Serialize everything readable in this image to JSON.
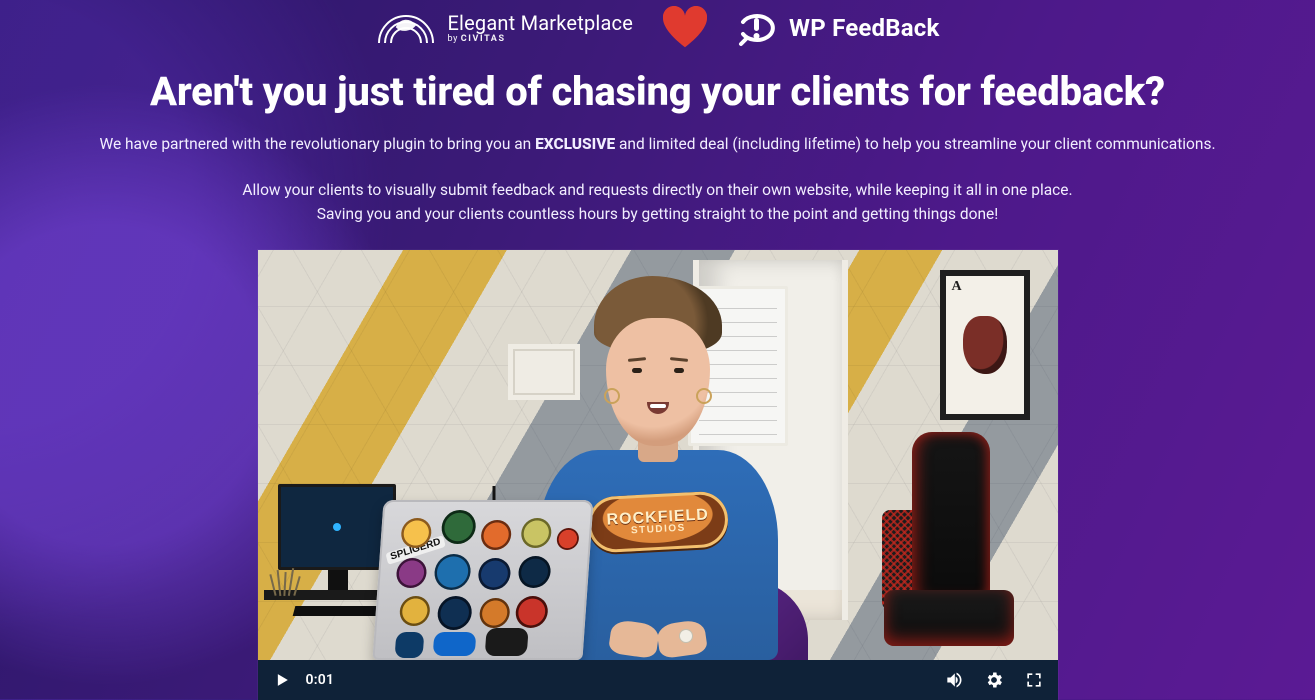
{
  "logos": {
    "elegant_marketplace": {
      "brand": "Elegant Marketplace",
      "byline_prefix": "by",
      "byline_brand": "CIVITAS"
    },
    "heart_icon": "heart-icon",
    "wp_feedback": {
      "name": "WP FeedBack"
    }
  },
  "headline": "Aren't you just tired of chasing your clients for feedback?",
  "sub1_pre": "We have partnered with the revolutionary plugin to bring you an ",
  "sub1_strong": "EXCLUSIVE",
  "sub1_post": " and limited deal (including lifetime) to help you streamline your client communications.",
  "sub2_line1": "Allow your clients to visually submit feedback and requests directly on their own website, while keeping it all in one place.",
  "sub2_line2": "Saving you and your clients countless hours by getting straight to the point and getting things done!",
  "video": {
    "tshirt_line1": "ROCKFIELD",
    "tshirt_line2": "STUDIOS",
    "laptop_tag": "SPLIGERD",
    "controls": {
      "play_label": "Play",
      "current_time": "0:01",
      "volume_label": "Volume",
      "settings_label": "Settings",
      "fullscreen_label": "Fullscreen"
    }
  },
  "colors": {
    "accent_heart": "#e03a2f",
    "control_bar": "#0f2238"
  }
}
